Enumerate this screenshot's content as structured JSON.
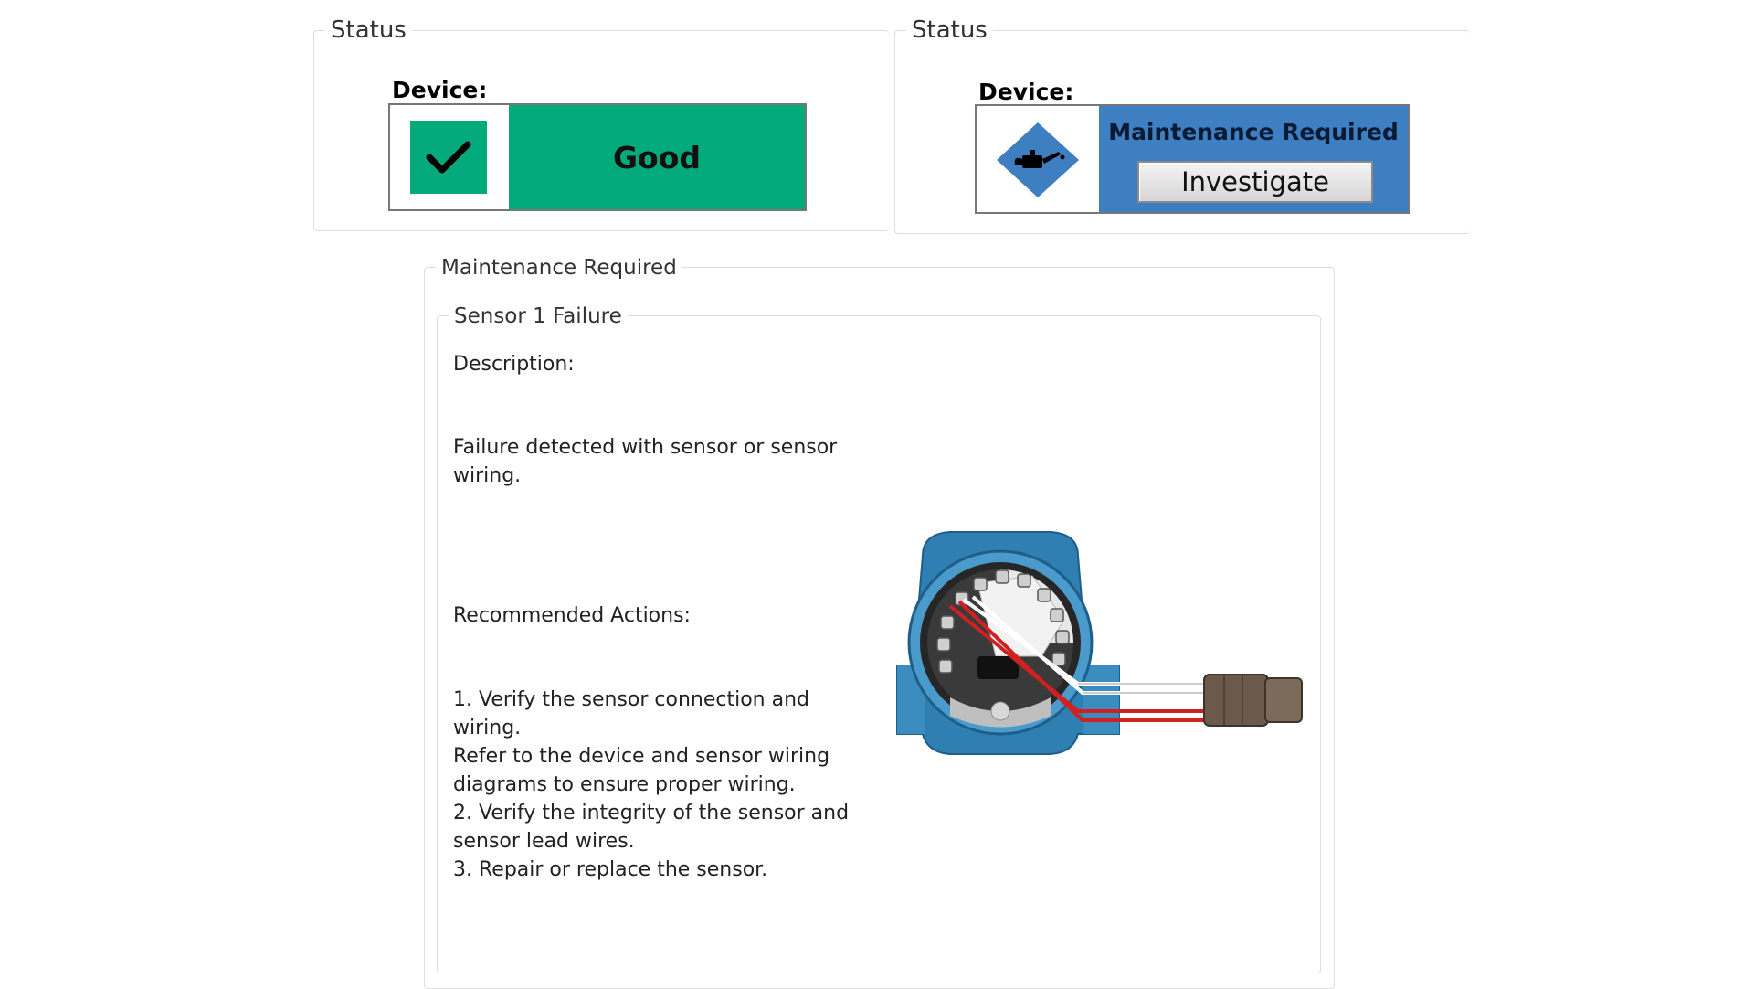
{
  "status_good": {
    "title": "Status",
    "device_label": "Device:",
    "state": "Good",
    "icon": "checkmark-icon",
    "color": "#05aa7c"
  },
  "status_maint": {
    "title": "Status",
    "device_label": "Device:",
    "state": "Maintenance Required",
    "button_label": "Investigate",
    "icon": "oil-can-icon",
    "color": "#3e7fc1"
  },
  "maintenance": {
    "title": "Maintenance Required",
    "failure_title": "Sensor 1 Failure",
    "description_heading": "Description:",
    "description_text": "Failure detected with sensor or sensor\nwiring.",
    "actions_heading": "Recommended Actions:",
    "actions_text": "1. Verify the sensor connection and wiring.\nRefer to the device and sensor wiring\ndiagrams to ensure proper wiring.\n2. Verify the integrity of the sensor and\nsensor lead wires.\n3. Repair or replace the sensor.",
    "illustration": "transmitter-wiring-illustration"
  }
}
